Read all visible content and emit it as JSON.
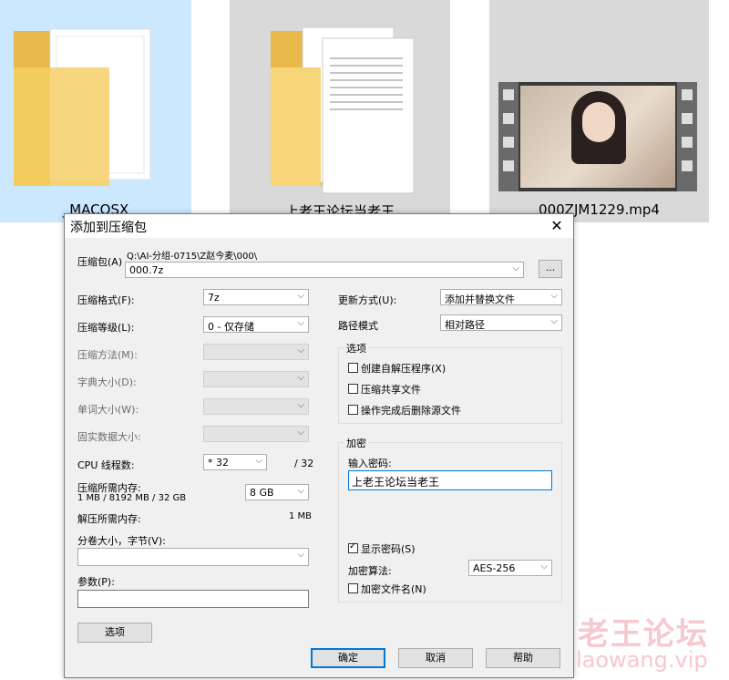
{
  "explorer": {
    "items": [
      {
        "name": "_MACOSX"
      },
      {
        "name": "上老王论坛当老王"
      },
      {
        "name": "000ZJM1229.mp4"
      }
    ]
  },
  "dialog": {
    "title": "添加到压缩包",
    "archive": {
      "label": "压缩包(A)",
      "path": "Q:\\AI-分组-0715\\Z赵今麦\\000\\",
      "value": "000.7z",
      "browse_label": "..."
    },
    "left": {
      "format": {
        "label": "压缩格式(F):",
        "value": "7z"
      },
      "level": {
        "label": "压缩等级(L):",
        "value": "0 - 仅存储"
      },
      "method": {
        "label": "压缩方法(M):",
        "value": ""
      },
      "dict": {
        "label": "字典大小(D):",
        "value": ""
      },
      "word": {
        "label": "单词大小(W):",
        "value": ""
      },
      "solid": {
        "label": "固实数据大小:",
        "value": ""
      },
      "threads": {
        "label": "CPU 线程数:",
        "value": "* 32",
        "max": "/ 32"
      },
      "mem_compress": {
        "label": "压缩所需内存:",
        "detail": "1 MB / 8192 MB / 32 GB",
        "value": "8 GB"
      },
      "mem_decompress": {
        "label": "解压所需内存:",
        "value": "1 MB"
      },
      "volume": {
        "label": "分卷大小，字节(V):",
        "value": ""
      },
      "params": {
        "label": "参数(P):",
        "value": ""
      },
      "options_button": "选项"
    },
    "right": {
      "update_mode": {
        "label": "更新方式(U):",
        "value": "添加并替换文件"
      },
      "path_mode": {
        "label": "路径模式",
        "value": "相对路径"
      },
      "options_group": {
        "title": "选项",
        "sfx": {
          "label": "创建自解压程序(X)",
          "checked": false
        },
        "shared": {
          "label": "压缩共享文件",
          "checked": false
        },
        "delete": {
          "label": "操作完成后删除源文件",
          "checked": false
        }
      },
      "encrypt_group": {
        "title": "加密",
        "password_label": "输入密码:",
        "password_value": "上老王论坛当老王",
        "show_password": {
          "label": "显示密码(S)",
          "checked": true
        },
        "method_label": "加密算法:",
        "method_value": "AES-256",
        "encrypt_names": {
          "label": "加密文件名(N)",
          "checked": false
        }
      }
    },
    "buttons": {
      "ok": "确定",
      "cancel": "取消",
      "help": "帮助"
    }
  },
  "watermark": {
    "line1": "老王论坛",
    "line2": "laowang.vip"
  }
}
